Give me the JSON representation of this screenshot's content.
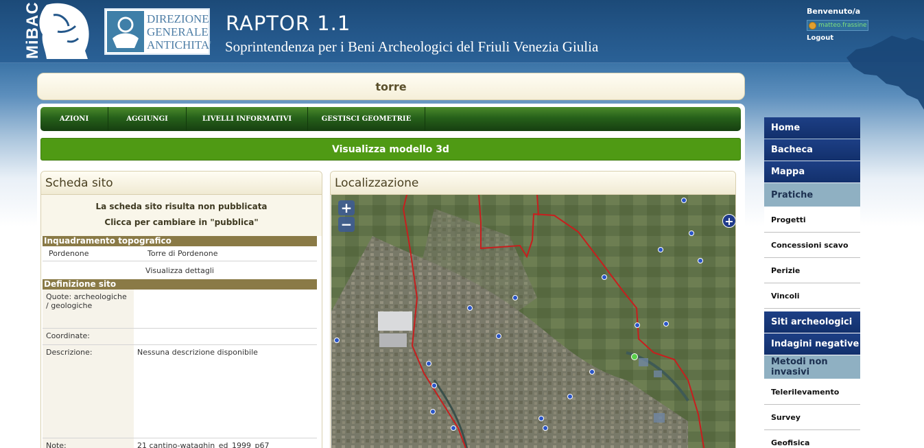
{
  "header": {
    "logo_text": "MiBAC",
    "dga_text": "DIREZIONE GENERALE ANTICHITA'",
    "app_title": "RAPTOR 1.1",
    "app_subtitle": "Soprintendenza per i Beni Archeologici del Friuli Venezia Giulia",
    "welcome": "Benvenuto/a",
    "username": "matteo.frassine",
    "logout": "Logout"
  },
  "page": {
    "title": "torre"
  },
  "toolbar": {
    "items": [
      "AZIONI",
      "AGGIUNGI",
      "LIVELLI INFORMATIVI",
      "GESTISCI GEOMETRIE"
    ]
  },
  "model_button": "Visualizza modello 3d",
  "scheda": {
    "title": "Scheda sito",
    "status_line1": "La scheda sito risulta non pubblicata",
    "status_line2": "Clicca per cambiare in \"pubblica\"",
    "section_topo": "Inquadramento topografico",
    "topo_comune": "Pordenone",
    "topo_localita": "Torre di Pordenone",
    "details_link": "Visualizza dettagli",
    "section_def": "Definizione sito",
    "fields": [
      {
        "label": "Quote: archeologiche / geologiche",
        "value": ""
      },
      {
        "label": "Coordinate:",
        "value": ""
      },
      {
        "label": "Descrizione:",
        "value": "Nessuna descrizione disponibile"
      },
      {
        "label": "Note:",
        "value": "21 cantino-wataghin_ed_1999_p67"
      }
    ]
  },
  "localizzazione": {
    "title": "Localizzazione",
    "zoom_in": "+",
    "zoom_out": "−",
    "layer_switch": "+"
  },
  "nav": {
    "items": [
      {
        "label": "Home",
        "type": "main"
      },
      {
        "label": "Bacheca",
        "type": "main"
      },
      {
        "label": "Mappa",
        "type": "main"
      },
      {
        "label": "Pratiche",
        "type": "active"
      },
      {
        "label": "Progetti",
        "type": "sub"
      },
      {
        "label": "Concessioni scavo",
        "type": "sub"
      },
      {
        "label": "Perizie",
        "type": "sub"
      },
      {
        "label": "Vincoli",
        "type": "sub"
      },
      {
        "label": "Siti archeologici",
        "type": "main"
      },
      {
        "label": "Indagini negative",
        "type": "main"
      },
      {
        "label": "Metodi non invasivi",
        "type": "active"
      },
      {
        "label": "Telerilevamento",
        "type": "sub"
      },
      {
        "label": "Survey",
        "type": "sub"
      },
      {
        "label": "Geofisica",
        "type": "sub"
      }
    ]
  },
  "colors": {
    "header_blue": "#24578a",
    "toolbar_green": "#26601a",
    "model_green": "#4f9a14",
    "section_brown": "#8a7a46",
    "nav_blue": "#12306c"
  }
}
